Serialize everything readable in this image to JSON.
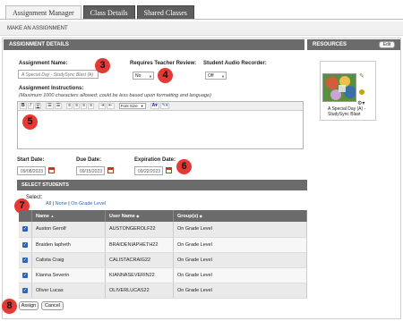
{
  "tabs": [
    {
      "label": "Assignment Manager"
    },
    {
      "label": "Class Details"
    },
    {
      "label": "Shared Classes"
    }
  ],
  "subheader": "MAKE AN ASSIGNMENT",
  "details_header": "ASSIGNMENT DETAILS",
  "resources": {
    "header": "RESOURCES",
    "edit_label": "Edit",
    "item_caption": "A Special Day (A) - StudySync Blast"
  },
  "form": {
    "assignment_name_label": "Assignment Name:",
    "assignment_name_value": "A Special Day - StudySync Blast (A)",
    "teacher_review_label": "Requires Teacher Review:",
    "teacher_review_value": "No",
    "audio_recorder_label": "Student Audio Recorder:",
    "audio_recorder_value": "Off",
    "instructions_label": "Assignment Instructions:",
    "instructions_note": "(Maximum 1000 characters allowed; could be less based upon formatting and language)",
    "font_select": "Font Size",
    "start_date_label": "Start Date:",
    "start_date_value": "09/08/2023",
    "due_date_label": "Due Date:",
    "due_date_value": "09/15/2023",
    "expiration_date_label": "Expiration Date:",
    "expiration_date_value": "09/22/2023"
  },
  "toolbar_buttons": [
    "B",
    "I",
    "U",
    "☰",
    "☰",
    "≡",
    "≡",
    "≡",
    "≡",
    "⇥",
    "⇤"
  ],
  "students": {
    "header": "SELECT STUDENTS",
    "select_label": "Select:",
    "select_all": "All",
    "select_none": "None",
    "select_grade": "On Grade Level",
    "columns": [
      "Name",
      "User Name",
      "Group(s)"
    ],
    "rows": [
      {
        "name": "Auston Gerolf",
        "username": "AUSTONGEROLF22",
        "group": "On Grade Level"
      },
      {
        "name": "Braiden Iapheth",
        "username": "BRAIDENIAPHETH22",
        "group": "On Grade Level"
      },
      {
        "name": "Calista Craig",
        "username": "CALISTACRAIG22",
        "group": "On Grade Level"
      },
      {
        "name": "Kianna Severin",
        "username": "KIANNASEVERIN22",
        "group": "On Grade Level"
      },
      {
        "name": "Oliver Lucas",
        "username": "OLIVERLUCAS22",
        "group": "On Grade Level"
      }
    ]
  },
  "buttons": {
    "assign": "Assign",
    "cancel": "Cancel"
  },
  "markers": [
    "3",
    "4",
    "5",
    "6",
    "7",
    "8"
  ],
  "colors": {
    "marker": "#e53935",
    "header_gray": "#6b6b6b",
    "link": "#2a63b8"
  }
}
